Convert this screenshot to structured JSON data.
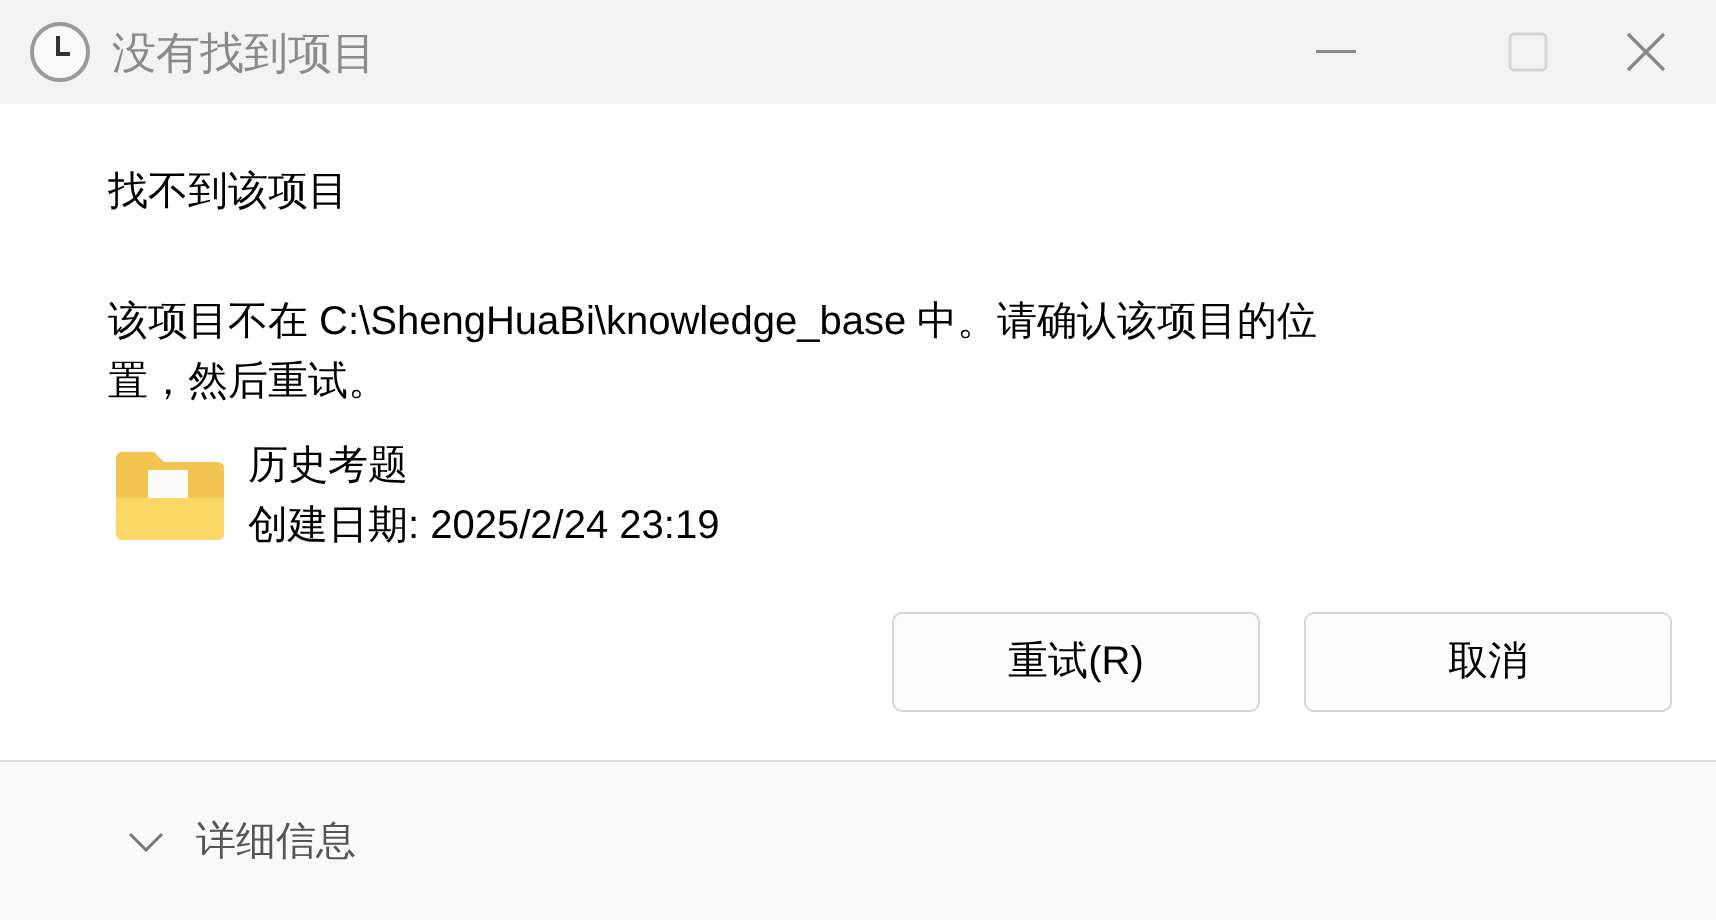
{
  "window": {
    "title": "没有找到项目",
    "active": false,
    "maximize_disabled": true
  },
  "heading": "找不到该项目",
  "message": "该项目不在 C:\\ShengHuaBi\\knowledge_base 中。请确认该项目的位置，然后重试。",
  "item": {
    "name": "历史考题",
    "created": "创建日期: 2025/2/24 23:19"
  },
  "buttons": [
    {
      "label": "重试(R)"
    },
    {
      "label": "取消"
    }
  ],
  "details": {
    "label": "详细信息",
    "expanded": false
  }
}
